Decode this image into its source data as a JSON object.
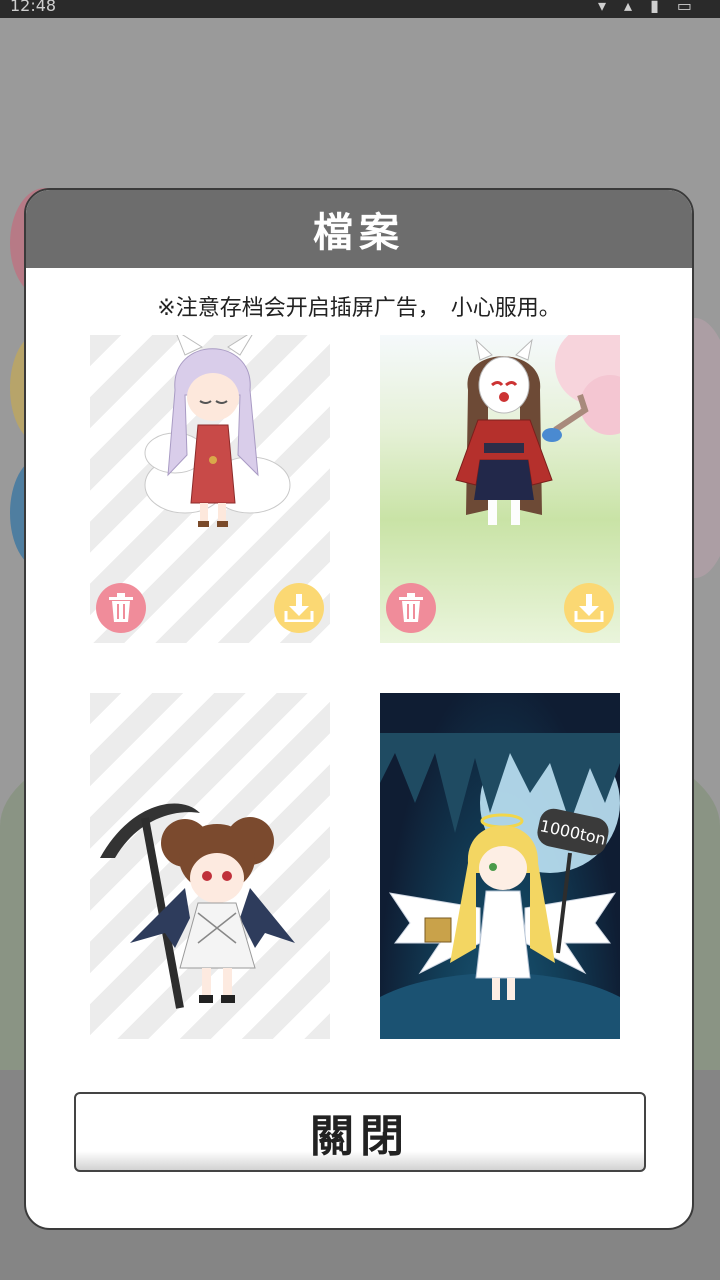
{
  "status_bar": {
    "time": "12:48"
  },
  "dialog": {
    "title": "檔案",
    "notice": "※注意存档会开启插屏广告，　小心服用。",
    "close_label": "關閉"
  },
  "slots": [
    {
      "name": "slot-1",
      "background": "striped",
      "character": "fox girl",
      "has_buttons": true
    },
    {
      "name": "slot-2",
      "background": "meadow",
      "character": "masked kimono girl",
      "has_buttons": true
    },
    {
      "name": "slot-3",
      "background": "striped",
      "character": "scythe demon girl",
      "has_buttons": false
    },
    {
      "name": "slot-4",
      "background": "cave",
      "character": "angel girl",
      "sign_text": "1000ton",
      "has_buttons": false
    }
  ],
  "icons": {
    "delete": "trash-icon",
    "download": "download-icon"
  },
  "colors": {
    "header": "#6d6d6d",
    "delete_button": "#f08c9a",
    "download_button": "#fbd873"
  }
}
